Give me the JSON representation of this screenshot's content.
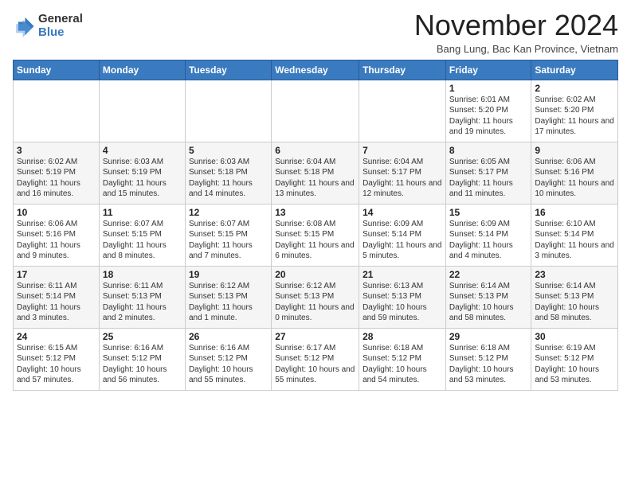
{
  "logo": {
    "general": "General",
    "blue": "Blue"
  },
  "header": {
    "month": "November 2024",
    "location": "Bang Lung, Bac Kan Province, Vietnam"
  },
  "weekdays": [
    "Sunday",
    "Monday",
    "Tuesday",
    "Wednesday",
    "Thursday",
    "Friday",
    "Saturday"
  ],
  "weeks": [
    [
      {
        "day": "",
        "info": ""
      },
      {
        "day": "",
        "info": ""
      },
      {
        "day": "",
        "info": ""
      },
      {
        "day": "",
        "info": ""
      },
      {
        "day": "",
        "info": ""
      },
      {
        "day": "1",
        "info": "Sunrise: 6:01 AM\nSunset: 5:20 PM\nDaylight: 11 hours and 19 minutes."
      },
      {
        "day": "2",
        "info": "Sunrise: 6:02 AM\nSunset: 5:20 PM\nDaylight: 11 hours and 17 minutes."
      }
    ],
    [
      {
        "day": "3",
        "info": "Sunrise: 6:02 AM\nSunset: 5:19 PM\nDaylight: 11 hours and 16 minutes."
      },
      {
        "day": "4",
        "info": "Sunrise: 6:03 AM\nSunset: 5:19 PM\nDaylight: 11 hours and 15 minutes."
      },
      {
        "day": "5",
        "info": "Sunrise: 6:03 AM\nSunset: 5:18 PM\nDaylight: 11 hours and 14 minutes."
      },
      {
        "day": "6",
        "info": "Sunrise: 6:04 AM\nSunset: 5:18 PM\nDaylight: 11 hours and 13 minutes."
      },
      {
        "day": "7",
        "info": "Sunrise: 6:04 AM\nSunset: 5:17 PM\nDaylight: 11 hours and 12 minutes."
      },
      {
        "day": "8",
        "info": "Sunrise: 6:05 AM\nSunset: 5:17 PM\nDaylight: 11 hours and 11 minutes."
      },
      {
        "day": "9",
        "info": "Sunrise: 6:06 AM\nSunset: 5:16 PM\nDaylight: 11 hours and 10 minutes."
      }
    ],
    [
      {
        "day": "10",
        "info": "Sunrise: 6:06 AM\nSunset: 5:16 PM\nDaylight: 11 hours and 9 minutes."
      },
      {
        "day": "11",
        "info": "Sunrise: 6:07 AM\nSunset: 5:15 PM\nDaylight: 11 hours and 8 minutes."
      },
      {
        "day": "12",
        "info": "Sunrise: 6:07 AM\nSunset: 5:15 PM\nDaylight: 11 hours and 7 minutes."
      },
      {
        "day": "13",
        "info": "Sunrise: 6:08 AM\nSunset: 5:15 PM\nDaylight: 11 hours and 6 minutes."
      },
      {
        "day": "14",
        "info": "Sunrise: 6:09 AM\nSunset: 5:14 PM\nDaylight: 11 hours and 5 minutes."
      },
      {
        "day": "15",
        "info": "Sunrise: 6:09 AM\nSunset: 5:14 PM\nDaylight: 11 hours and 4 minutes."
      },
      {
        "day": "16",
        "info": "Sunrise: 6:10 AM\nSunset: 5:14 PM\nDaylight: 11 hours and 3 minutes."
      }
    ],
    [
      {
        "day": "17",
        "info": "Sunrise: 6:11 AM\nSunset: 5:14 PM\nDaylight: 11 hours and 3 minutes."
      },
      {
        "day": "18",
        "info": "Sunrise: 6:11 AM\nSunset: 5:13 PM\nDaylight: 11 hours and 2 minutes."
      },
      {
        "day": "19",
        "info": "Sunrise: 6:12 AM\nSunset: 5:13 PM\nDaylight: 11 hours and 1 minute."
      },
      {
        "day": "20",
        "info": "Sunrise: 6:12 AM\nSunset: 5:13 PM\nDaylight: 11 hours and 0 minutes."
      },
      {
        "day": "21",
        "info": "Sunrise: 6:13 AM\nSunset: 5:13 PM\nDaylight: 10 hours and 59 minutes."
      },
      {
        "day": "22",
        "info": "Sunrise: 6:14 AM\nSunset: 5:13 PM\nDaylight: 10 hours and 58 minutes."
      },
      {
        "day": "23",
        "info": "Sunrise: 6:14 AM\nSunset: 5:13 PM\nDaylight: 10 hours and 58 minutes."
      }
    ],
    [
      {
        "day": "24",
        "info": "Sunrise: 6:15 AM\nSunset: 5:12 PM\nDaylight: 10 hours and 57 minutes."
      },
      {
        "day": "25",
        "info": "Sunrise: 6:16 AM\nSunset: 5:12 PM\nDaylight: 10 hours and 56 minutes."
      },
      {
        "day": "26",
        "info": "Sunrise: 6:16 AM\nSunset: 5:12 PM\nDaylight: 10 hours and 55 minutes."
      },
      {
        "day": "27",
        "info": "Sunrise: 6:17 AM\nSunset: 5:12 PM\nDaylight: 10 hours and 55 minutes."
      },
      {
        "day": "28",
        "info": "Sunrise: 6:18 AM\nSunset: 5:12 PM\nDaylight: 10 hours and 54 minutes."
      },
      {
        "day": "29",
        "info": "Sunrise: 6:18 AM\nSunset: 5:12 PM\nDaylight: 10 hours and 53 minutes."
      },
      {
        "day": "30",
        "info": "Sunrise: 6:19 AM\nSunset: 5:12 PM\nDaylight: 10 hours and 53 minutes."
      }
    ]
  ]
}
